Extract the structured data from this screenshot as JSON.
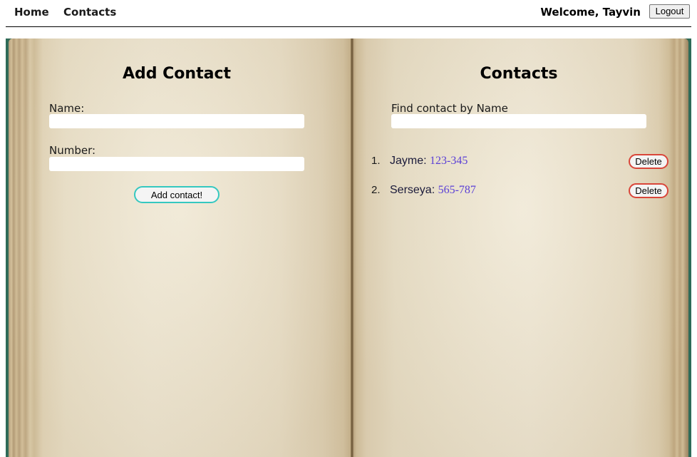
{
  "nav": {
    "home_label": "Home",
    "contacts_label": "Contacts",
    "welcome_text": "Welcome, Tayvin",
    "logout_label": "Logout"
  },
  "add_contact": {
    "title": "Add Contact",
    "name_label": "Name:",
    "name_value": "",
    "number_label": "Number:",
    "number_value": "",
    "submit_label": "Add contact!"
  },
  "contacts": {
    "title": "Contacts",
    "filter_label": "Find contact by Name",
    "filter_value": "",
    "delete_label": "Delete",
    "items": [
      {
        "index": "1.",
        "name": "Jayme",
        "separator": ": ",
        "number": "123-345"
      },
      {
        "index": "2.",
        "name": "Serseya",
        "separator": ": ",
        "number": "565-787"
      }
    ]
  },
  "colors": {
    "add_button_border": "#35c8c0",
    "delete_button_border": "#d9463a",
    "phone_number_text": "#5a3fd6",
    "book_background": "#2f6b58"
  }
}
